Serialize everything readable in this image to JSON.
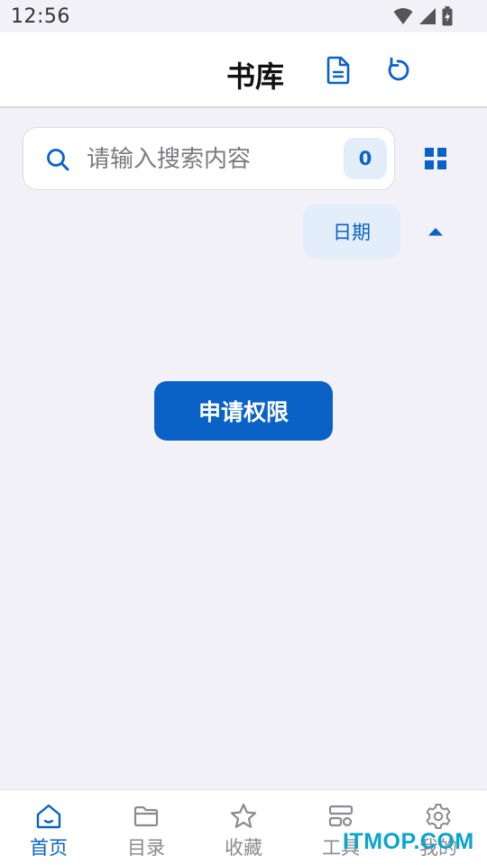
{
  "status_bar": {
    "time": "12:56",
    "icons": [
      "wifi-icon",
      "signal-icon",
      "battery-charging-icon"
    ]
  },
  "app_bar": {
    "title": "书库",
    "actions": [
      {
        "name": "document-icon",
        "color": "#0a62c6"
      },
      {
        "name": "refresh-icon",
        "color": "#0a62c6"
      }
    ]
  },
  "search": {
    "placeholder": "请输入搜索内容",
    "value": "",
    "count": "0"
  },
  "view_toggle": {
    "icon": "grid-view-icon"
  },
  "sort": {
    "label": "日期",
    "direction_icon": "caret-up-icon"
  },
  "main": {
    "request_permission_label": "申请权限"
  },
  "bottom_nav": {
    "items": [
      {
        "label": "首页",
        "icon": "home-icon",
        "active": true
      },
      {
        "label": "目录",
        "icon": "folder-icon",
        "active": false
      },
      {
        "label": "收藏",
        "icon": "star-icon",
        "active": false
      },
      {
        "label": "工具",
        "icon": "tools-icon",
        "active": false
      },
      {
        "label": "我的",
        "icon": "gear-icon",
        "active": false
      }
    ]
  },
  "watermark": "ITMOP.COM",
  "colors": {
    "accent": "#0a62c6",
    "chip_bg": "#e3eefb",
    "background": "#f1f1f7",
    "inactive": "#8a8a90"
  }
}
